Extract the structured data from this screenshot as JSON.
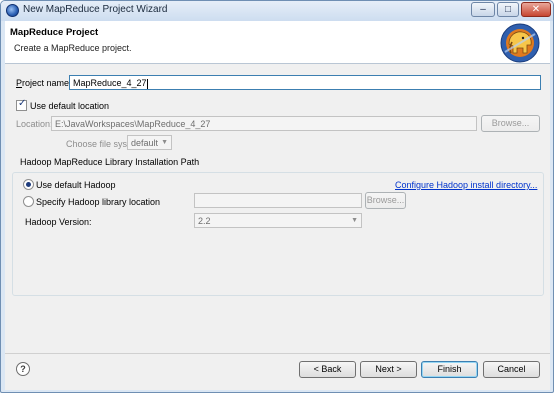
{
  "window": {
    "title": "New MapReduce Project Wizard",
    "min_glyph": "–",
    "max_glyph": "□",
    "close_glyph": "✕"
  },
  "header": {
    "title": "MapReduce Project",
    "description": "Create a MapReduce project."
  },
  "form": {
    "project_name_label": "Project name:",
    "project_name_value": "MapReduce_4_27",
    "use_default_location_label": "Use default location",
    "use_default_location_checked": true,
    "location_label": "Location:",
    "location_value": "E:\\JavaWorkspaces\\MapReduce_4_27",
    "browse_label": "Browse...",
    "file_system_label": "Choose file system:",
    "file_system_value": "default"
  },
  "hadoop_group": {
    "title": "Hadoop MapReduce Library Installation Path",
    "use_default_label": "Use default Hadoop",
    "use_default_selected": true,
    "configure_link": "Configure Hadoop install directory...",
    "specify_location_label": "Specify Hadoop library location",
    "specify_location_value": "",
    "browse_label": "Browse...",
    "version_label": "Hadoop Version:",
    "version_value": "2.2"
  },
  "footer": {
    "help_glyph": "?",
    "back_label": "< Back",
    "next_label": "Next >",
    "finish_label": "Finish",
    "cancel_label": "Cancel"
  },
  "icons": {
    "app": "eclipse-app-icon",
    "wizard_banner": "hadoop-elephant-icon",
    "help": "help-icon"
  },
  "colors": {
    "link": "#0033cc",
    "title_bar": "#cdddf0",
    "close_button": "#c74631",
    "default_button_border": "#3c7fb1"
  }
}
